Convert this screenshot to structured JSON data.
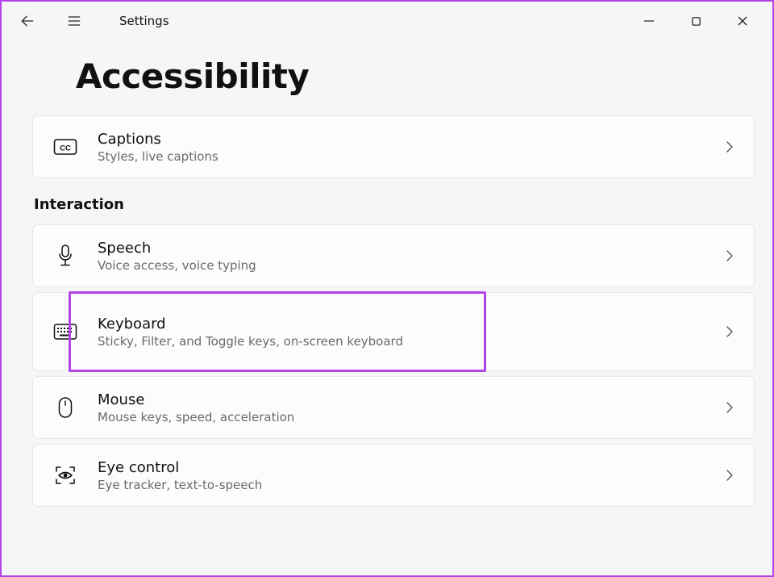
{
  "app_title": "Settings",
  "page_title": "Accessibility",
  "section_label": "Interaction",
  "cards": {
    "captions": {
      "title": "Captions",
      "sub": "Styles, live captions"
    },
    "speech": {
      "title": "Speech",
      "sub": "Voice access, voice typing"
    },
    "keyboard": {
      "title": "Keyboard",
      "sub": "Sticky, Filter, and Toggle keys, on-screen keyboard"
    },
    "mouse": {
      "title": "Mouse",
      "sub": "Mouse keys, speed, acceleration"
    },
    "eyecontrol": {
      "title": "Eye control",
      "sub": "Eye tracker, text-to-speech"
    }
  }
}
